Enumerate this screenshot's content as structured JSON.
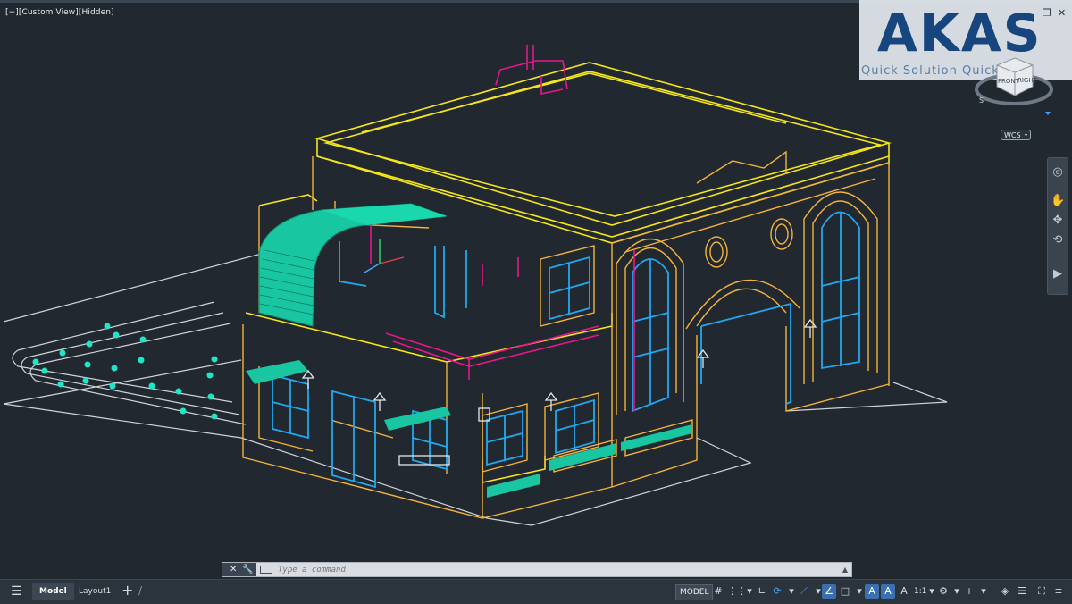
{
  "viewport": {
    "label": "[−][Custom View][Hidden]"
  },
  "logo": {
    "text": "AKAS",
    "tagline": "Quick Solution Quick"
  },
  "window_controls": {
    "minimize": "−",
    "restore": "❐",
    "close": "✕"
  },
  "viewcube": {
    "front": "FRONT",
    "right": "RIGHT",
    "south": "S"
  },
  "wcs": {
    "label": "WCS"
  },
  "command_line": {
    "close_glyph": "✕",
    "customize_glyph": "🔧",
    "placeholder": "Type a command",
    "history_glyph": "▲"
  },
  "statusbar": {
    "menu_glyph": "☰",
    "tabs": [
      {
        "label": "Model",
        "active": true
      },
      {
        "label": "Layout1",
        "active": false
      }
    ],
    "add_tab": "+",
    "model_button": "MODEL",
    "annotation_scale": "1:1"
  },
  "colors": {
    "background": "#212830",
    "yellow": "#f5e61b",
    "orange": "#f3b33c",
    "cyan": "#21a8f0",
    "magenta": "#e8168c",
    "green": "#16c99a",
    "white": "#d8d8d8"
  }
}
